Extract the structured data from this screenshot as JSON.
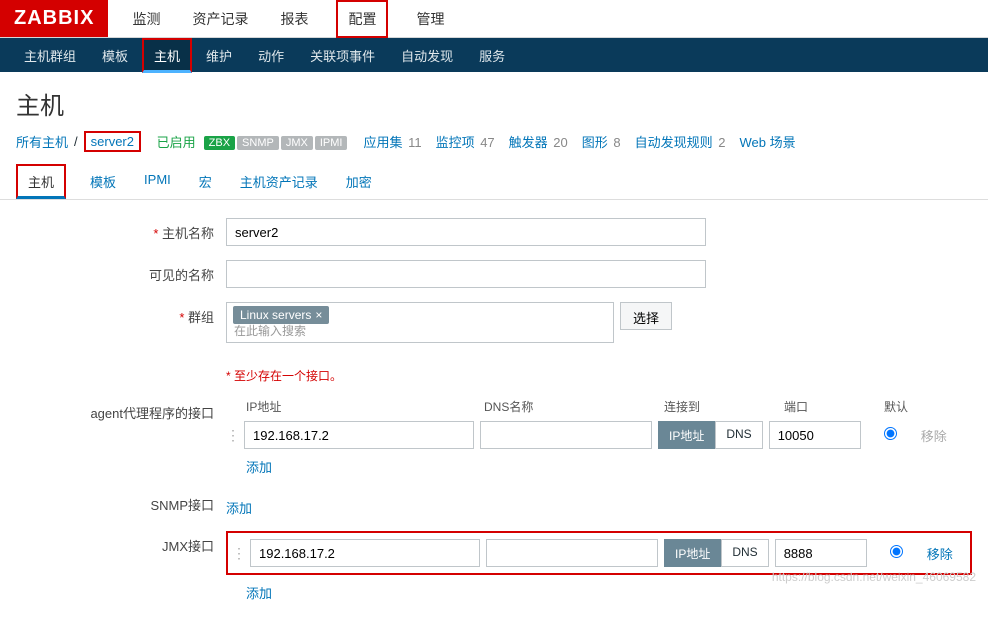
{
  "logo": "ZABBIX",
  "topnav": [
    "监测",
    "资产记录",
    "报表",
    "配置",
    "管理"
  ],
  "topnav_active": 3,
  "subnav": [
    "主机群组",
    "模板",
    "主机",
    "维护",
    "动作",
    "关联项事件",
    "自动发现",
    "服务"
  ],
  "subnav_active": 2,
  "page_title": "主机",
  "breadcrumb": {
    "all_hosts": "所有主机",
    "host": "server2",
    "enabled": "已启用",
    "badges": [
      {
        "t": "ZBX",
        "c": "zbx"
      },
      {
        "t": "SNMP",
        "c": "gray"
      },
      {
        "t": "JMX",
        "c": "gray"
      },
      {
        "t": "IPMI",
        "c": "gray"
      }
    ],
    "items": [
      {
        "label": "应用集",
        "count": "11"
      },
      {
        "label": "监控项",
        "count": "47"
      },
      {
        "label": "触发器",
        "count": "20"
      },
      {
        "label": "图形",
        "count": "8"
      },
      {
        "label": "自动发现规则",
        "count": "2"
      },
      {
        "label": "Web 场景",
        "count": ""
      }
    ]
  },
  "tabs": [
    "主机",
    "模板",
    "IPMI",
    "宏",
    "主机资产记录",
    "加密"
  ],
  "tabs_active": 0,
  "labels": {
    "host_name": "主机名称",
    "visible_name": "可见的名称",
    "groups": "群组",
    "groups_ph": "在此输入搜索",
    "select": "选择",
    "iface_note": "至少存在一个接口。",
    "agent_if": "agent代理程序的接口",
    "snmp_if": "SNMP接口",
    "jmx_if": "JMX接口",
    "ip": "IP地址",
    "dns": "DNS名称",
    "connect_to": "连接到",
    "port": "端口",
    "default": "默认",
    "ip_btn": "IP地址",
    "dns_btn": "DNS",
    "remove": "移除",
    "add": "添加"
  },
  "host_name": "server2",
  "visible_name": "",
  "group_tag": "Linux servers",
  "agent": {
    "ip": "192.168.17.2",
    "dns": "",
    "port": "10050"
  },
  "jmx": {
    "ip": "192.168.17.2",
    "dns": "",
    "port": "8888"
  },
  "watermark": "https://blog.csdn.net/weixin_46069582"
}
